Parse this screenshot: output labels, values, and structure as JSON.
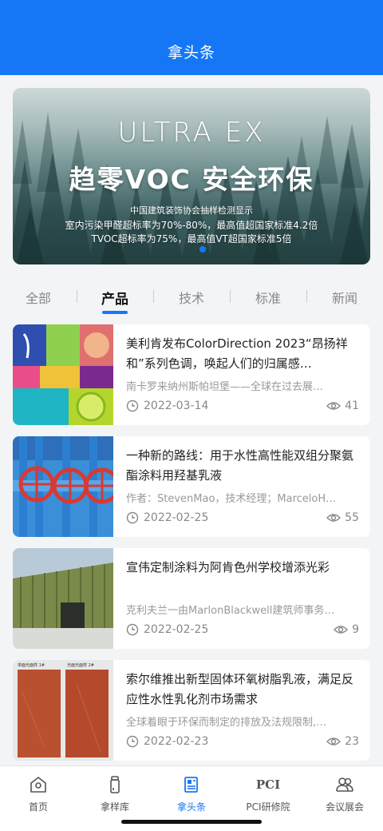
{
  "header": {
    "title": "拿头条"
  },
  "banner": {
    "brand": "ULTRA EX",
    "slogan": "趋零VOC  安全环保",
    "line1": "中国建筑装饰协会抽样检测显示",
    "line2": "室内污染甲醛超标率为70%-80%，最高值超国家标准4.2倍",
    "line3": "TVOC超标率为75%，最高值VT超国家标准5倍",
    "active_dot_color": "#1677f6"
  },
  "tabs": [
    {
      "label": "全部",
      "active": false
    },
    {
      "label": "产品",
      "active": true
    },
    {
      "label": "技术",
      "active": false
    },
    {
      "label": "标准",
      "active": false
    },
    {
      "label": "新闻",
      "active": false
    }
  ],
  "articles": [
    {
      "title": "美利肯发布ColorDirection 2023“昂扬祥和”系列色调，唤起人们的归属感…",
      "desc": "南卡罗来纳州斯帕坦堡——全球在过去展…",
      "date": "2022-03-14",
      "views": "41"
    },
    {
      "title": "一种新的路线：用于水性高性能双组分聚氨酯涂料用羟基乳液",
      "desc": "作者：StevenMao，技术经理；MarceloH…",
      "date": "2022-02-25",
      "views": "55"
    },
    {
      "title": "宣伟定制涂料为阿肯色州学校增添光彩",
      "desc": "克利夫兰一由MarlonBlackwell建筑师事务…",
      "date": "2022-02-25",
      "views": "9"
    },
    {
      "title": "索尔维推出新型固体环氧树脂乳液，满足反应性水性乳化剂市场需求",
      "desc": "全球着眼于环保而制定的排放及法规限制,…",
      "date": "2022-02-23",
      "views": "23",
      "thumb_caption_left": "单面光面样 1#",
      "thumb_caption_right": "光面光面样 2#"
    }
  ],
  "tabbar": [
    {
      "label": "首页",
      "icon": "home-icon",
      "active": false
    },
    {
      "label": "拿样库",
      "icon": "sample-bottle-icon",
      "active": false
    },
    {
      "label": "拿头条",
      "icon": "news-icon",
      "active": true
    },
    {
      "label": "PCI研修院",
      "icon": "pci-logo-icon",
      "icon_text": "PCI",
      "active": false
    },
    {
      "label": "会议展会",
      "icon": "meeting-icon",
      "active": false
    }
  ],
  "colors": {
    "primary": "#1677f6",
    "inactive": "#555555"
  }
}
